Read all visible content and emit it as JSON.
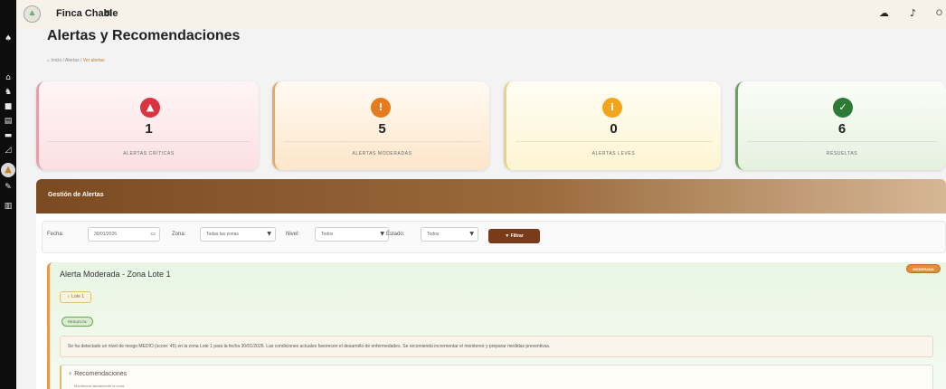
{
  "app": {
    "brand": "Finca Chable",
    "user_initials": "O"
  },
  "header": {
    "title": "Alertas y Recomendaciones",
    "breadcrumb": {
      "home": "Inicio",
      "middle": "Alertas",
      "current": "Ver alertas"
    }
  },
  "sidebar": {
    "icons": [
      "leaf-icon",
      "home-icon",
      "cow-icon",
      "grid-icon",
      "clipboard-icon",
      "truck-icon",
      "chart-icon",
      "alert-icon",
      "wrench-icon",
      "report-icon"
    ]
  },
  "stats": [
    {
      "count": "1",
      "label": "ALERTAS CRÍTICAS",
      "color": "#d9343f",
      "symbol": "▲"
    },
    {
      "count": "5",
      "label": "ALERTAS MODERADAS",
      "color": "#e57a1e",
      "symbol": "!"
    },
    {
      "count": "0",
      "label": "ALERTAS LEVES",
      "color": "#f1a51c",
      "symbol": "i"
    },
    {
      "count": "6",
      "label": "RESUELTAS",
      "color": "#2e7a37",
      "symbol": "✓"
    }
  ],
  "panel": {
    "title": "Gestión de Alertas"
  },
  "filters": {
    "date_label": "Fecha:",
    "date_value": "30/01/2026",
    "zone_label": "Zona:",
    "zone_value": "Todas las zonas",
    "level_label": "Nivel:",
    "level_value": "Todos",
    "state_label": "Estado:",
    "state_value": "Todos",
    "filter_button": "▼ Filtrar"
  },
  "alert": {
    "title": "Alerta Moderada - Zona Lote 1",
    "badge": "MODERADA",
    "zone": "♀ Lote 1",
    "state": "RESUELTA",
    "message": "Se ha detectado un nivel de riesgo MEDIO (score: 45) en la zona Lote 1 para la fecha 30/01/2026. Las condiciones actuales favorecen el desarrollo de enfermedades. Se recomienda incrementar el monitoreo y preparar medidas preventivas.",
    "recommendations_title": "♀ Recomendaciones",
    "recommendation_item": "Monitorear diariamente la zona"
  },
  "colors": {
    "sidebar": "#0d0d0d",
    "accent_brown": "#7a3b1a",
    "panel_header": "#7a4a22"
  }
}
